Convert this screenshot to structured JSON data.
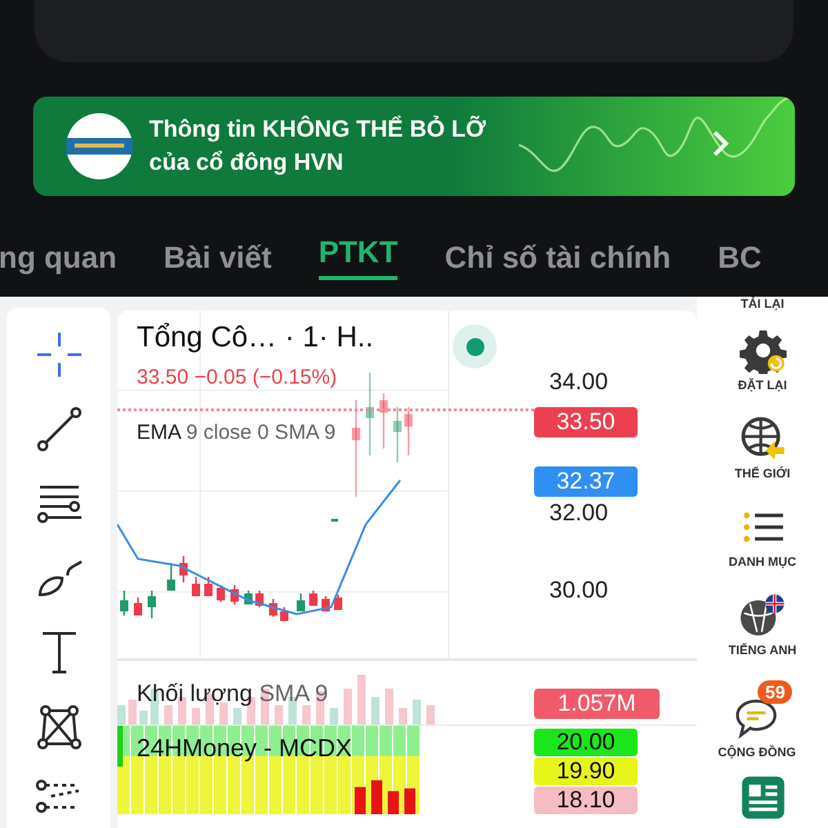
{
  "banner": {
    "lines": [
      "Thông tin KHÔNG THỂ BỎ LỠ",
      "của cổ đông HVN"
    ]
  },
  "tabs": [
    {
      "label": "ng quan",
      "selected": false
    },
    {
      "label": "Bài viết",
      "selected": false
    },
    {
      "label": "PTKT",
      "selected": true
    },
    {
      "label": "Chỉ số tài chính",
      "selected": false
    },
    {
      "label": "BC",
      "selected": false
    }
  ],
  "drawing_tools": [
    {
      "kind": "crosshair",
      "selected": true
    },
    {
      "kind": "line",
      "selected": false
    },
    {
      "kind": "lines",
      "selected": false
    },
    {
      "kind": "brush",
      "selected": false
    },
    {
      "kind": "text",
      "selected": false
    },
    {
      "kind": "pattern",
      "selected": false
    },
    {
      "kind": "fib",
      "selected": false
    }
  ],
  "chart": {
    "title": "Tổng Cô…  · 1· H..",
    "quote": "33.50  −0.05 (−0.15%)",
    "ema_legend": {
      "name": "EMA",
      "params": "9 close 0 SMA 9"
    },
    "price_axis": [
      "34.00",
      "32.00",
      "30.00"
    ],
    "price_badges": [
      {
        "value": "33.50",
        "color": "#ec3f4f"
      },
      {
        "value": "32.37",
        "color": "#2f8ff2"
      }
    ],
    "volume": {
      "name": "Khối lượng",
      "params": "SMA 9",
      "badge": "1.057M"
    },
    "mcdx": {
      "name": "24HMoney - MCDX",
      "badges": [
        {
          "value": "20.00",
          "color": "#1be61b"
        },
        {
          "value": "19.90",
          "color": "#e8f51a"
        },
        {
          "value": "18.10",
          "color": "#f6bcc4"
        }
      ]
    }
  },
  "side_menu": [
    {
      "kind": "reload",
      "label": "TẢI LẠI"
    },
    {
      "kind": "reset",
      "label": "ĐẶT LẠI"
    },
    {
      "kind": "world",
      "label": "THẾ GIỚI"
    },
    {
      "kind": "list",
      "label": "DANH MỤC"
    },
    {
      "kind": "english",
      "label": "TIẾNG ANH"
    },
    {
      "kind": "community",
      "label": "CỘNG ĐỒNG",
      "badge": "59"
    },
    {
      "kind": "news"
    }
  ]
}
